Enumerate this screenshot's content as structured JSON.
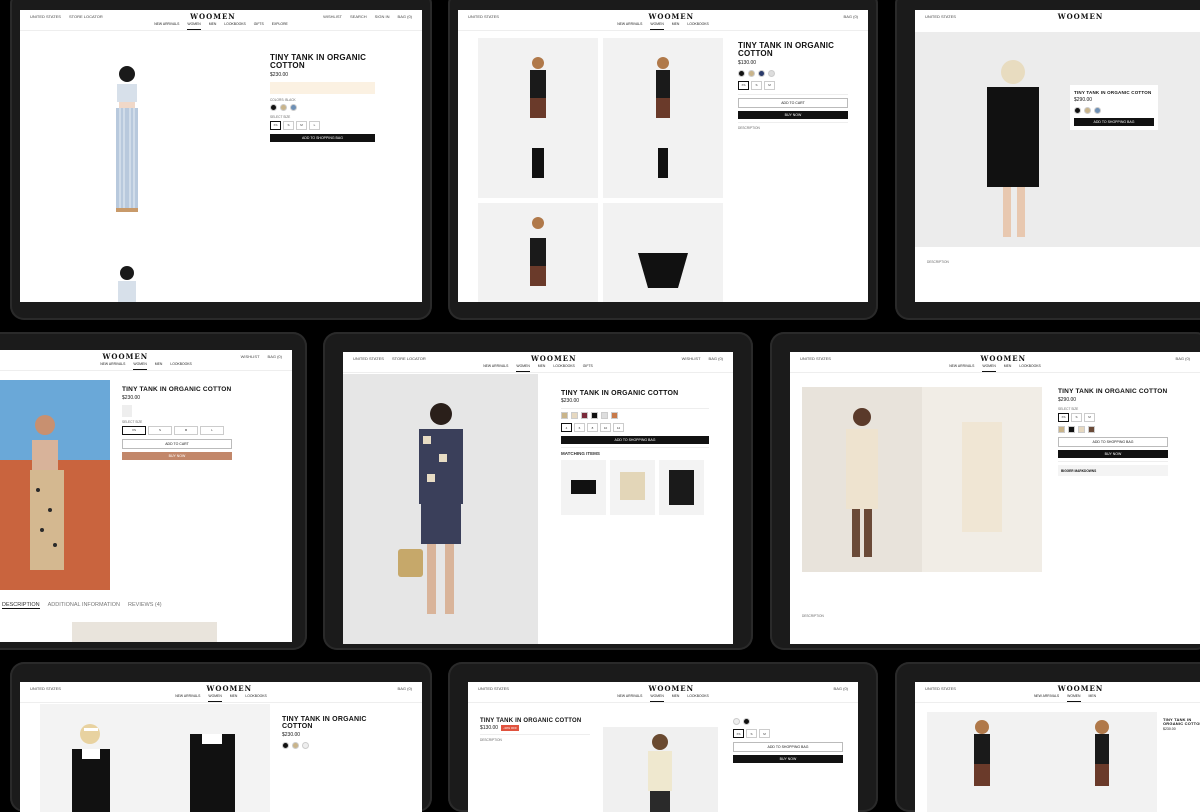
{
  "nav": {
    "logo": "WOOMEN",
    "left_links": [
      "UNITED STATES",
      "STORE LOCATOR"
    ],
    "right_links": [
      "WISHLIST",
      "SEARCH",
      "SIGN IN",
      "BAG (0)"
    ],
    "menu": [
      "NEW ARRIVALS",
      "WOMEN",
      "MEN",
      "LOOKBOOKS",
      "GIFTS",
      "EXPLORE"
    ]
  },
  "product": {
    "title": "TINY TANK IN ORGANIC COTTON",
    "price_230": "$230.00",
    "price_290": "$290.00",
    "price_130": "$130.00"
  },
  "tab_labels": [
    "DESCRIPTION",
    "ADDITIONAL INFORMATION",
    "REVIEWS (4)"
  ],
  "labels": {
    "add_to_bag": "ADD TO SHOPPING BAG",
    "buy_now": "BUY NOW",
    "add_to_cart": "ADD TO CART",
    "matching_items": "MATCHING ITEMS",
    "description": "DESCRIPTION",
    "colors": "COLORS: BLACK",
    "select_size": "SELECT SIZE",
    "sale": "-40% OFF",
    "bigger_markdowns": "BIGGER MARKDOWNS"
  },
  "colors": {
    "accent_tan": "#c2876a",
    "dark": "#111111",
    "sale_red": "#e0523e"
  }
}
